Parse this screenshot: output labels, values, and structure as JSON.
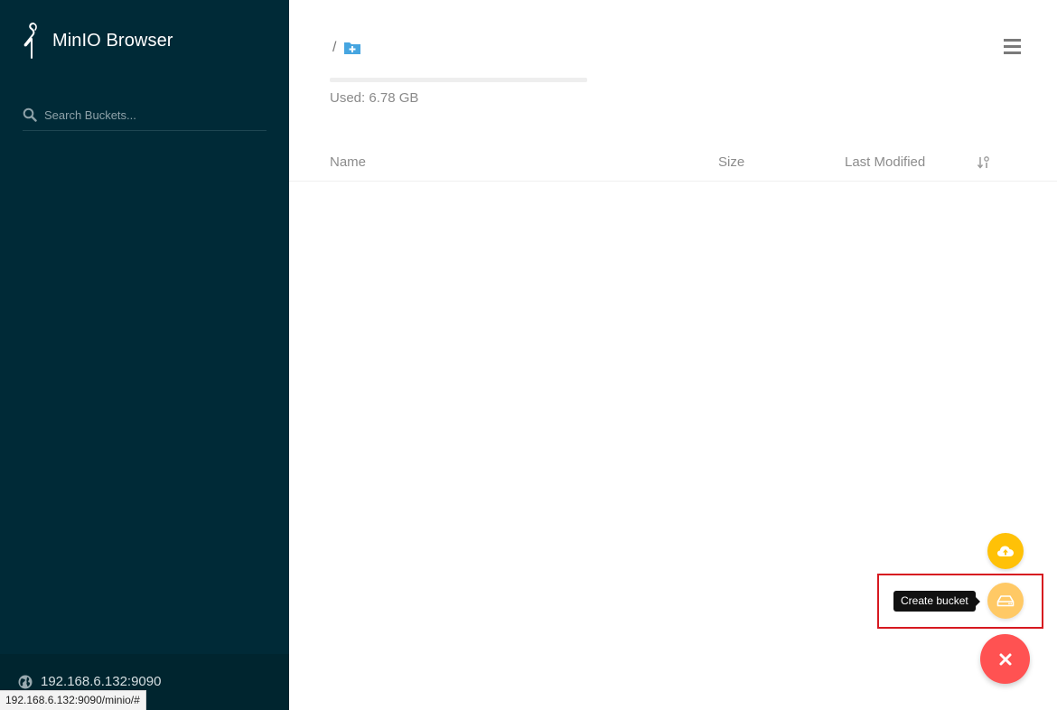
{
  "sidebar": {
    "logo": {
      "text": "MinIO Browser",
      "icon": "minio-crane-logo"
    },
    "search": {
      "placeholder": "Search Buckets...",
      "value": "",
      "icon": "search-icon"
    },
    "footer": {
      "host": "192.168.6.132:9090",
      "icon": "globe-icon"
    }
  },
  "status_bar": {
    "url": "192.168.6.132:9090/minio/#"
  },
  "main": {
    "breadcrumb": {
      "separator": "/",
      "icon": "folder-plus-icon"
    },
    "menu_icon": "hamburger-menu-icon",
    "usage": {
      "text": "Used: 6.78 GB",
      "fill_fraction": 0.0
    },
    "table": {
      "columns": {
        "name": "Name",
        "size": "Size",
        "modified": "Last Modified"
      },
      "sort_icon": "sort-icon",
      "rows": []
    }
  },
  "fab": {
    "upload_icon": "cloud-upload-icon",
    "create_bucket_icon": "hard-drive-icon",
    "close_icon": "close-icon",
    "tooltip": "Create bucket"
  },
  "colors": {
    "sidebar_bg": "#002a37",
    "upload_fab": "#ffc107",
    "bucket_fab": "#ffc965",
    "close_fab": "#ff5252",
    "highlight": "#d71920",
    "accent": "#46a5e0"
  }
}
